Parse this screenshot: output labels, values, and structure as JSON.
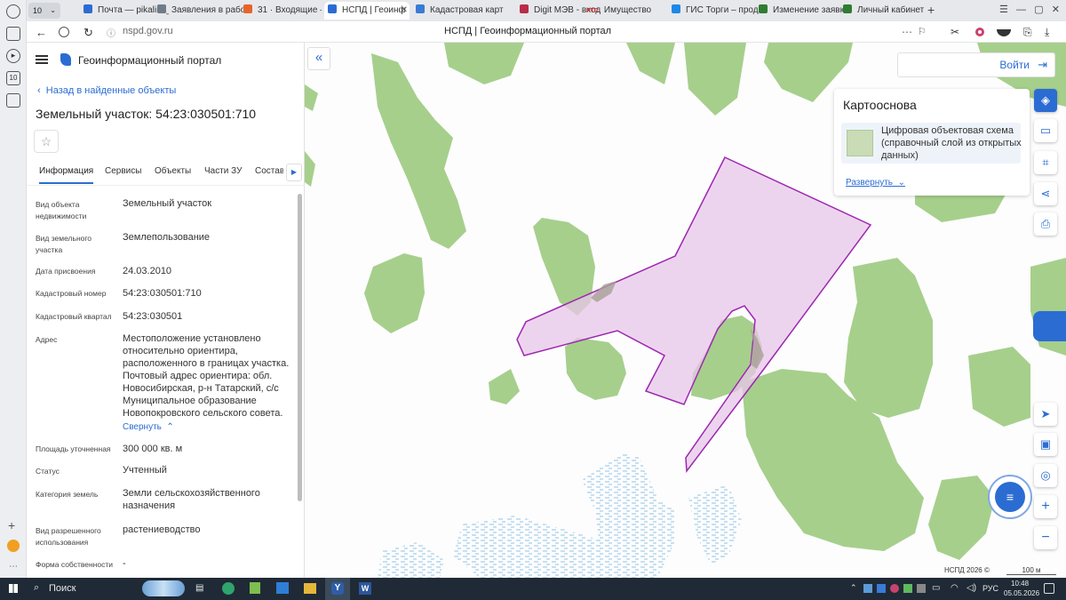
{
  "browser": {
    "tab_counter": "10",
    "tabs": [
      {
        "label": "Почта — pikalina_",
        "icon_color": "#2b6cd3"
      },
      {
        "label": "Заявления в рабо",
        "icon_color": "#6e7c8a"
      },
      {
        "label": "31 · Входящие — Я",
        "icon_color": "#e8632b"
      },
      {
        "label": "НСПД | Геоинф",
        "icon_color": "#2b6cd3"
      },
      {
        "label": "Кадастровая карт",
        "icon_color": "#3a7bd5"
      },
      {
        "label": "Digit МЭВ - вход",
        "icon_color": "#b82c4a"
      },
      {
        "label": "Имущество",
        "icon_color": "#d32f2f"
      },
      {
        "label": "ГИС Торги – прод",
        "icon_color": "#1e88e5"
      },
      {
        "label": "Изменение заявк",
        "icon_color": "#2e7d32"
      },
      {
        "label": "Личный кабинет",
        "icon_color": "#2e7d32"
      }
    ],
    "rtc_tag": "РТС",
    "url": "nspd.gov.ru",
    "page_title": "НСПД | Геоинформационный портал"
  },
  "panel": {
    "portal_title": "Геоинформационный портал",
    "back_link": "Назад в найденные объекты",
    "object_title": "Земельный участок: 54:23:030501:710",
    "tabs": [
      "Информация",
      "Сервисы",
      "Объекты",
      "Части ЗУ",
      "Состав"
    ],
    "fields": [
      {
        "label": "Вид объекта недвижимости",
        "value": "Земельный участок"
      },
      {
        "label": "Вид земельного участка",
        "value": "Землепользование"
      },
      {
        "label": "Дата присвоения",
        "value": "24.03.2010"
      },
      {
        "label": "Кадастровый номер",
        "value": "54:23:030501:710"
      },
      {
        "label": "Кадастровый квартал",
        "value": "54:23:030501"
      },
      {
        "label": "Адрес",
        "value": "Местоположение установлено относительно ориентира, расположенного в границах участка. Почтовый адрес ориентира: обл. Новосибирская, р-н Татарский, с/с Муниципальное образование Новопокровского сельского совета."
      },
      {
        "label": "Площадь уточненная",
        "value": "300 000 кв. м"
      },
      {
        "label": "Статус",
        "value": "Учтенный"
      },
      {
        "label": "Категория земель",
        "value": "Земли сельскохозяйственного назначения"
      },
      {
        "label": "Вид разрешенного использования",
        "value": "растениеводство"
      },
      {
        "label": "Форма собственности",
        "value": "-"
      }
    ],
    "collapse_link": "Свернуть"
  },
  "map": {
    "login_label": "Войти",
    "basemap_title": "Картооснова",
    "basemap_layer": "Цифровая объектовая схема (справочный слой из открытых данных)",
    "expand_link": "Развернуть",
    "copyright": "НСПД 2026 ©",
    "scale": "100 м",
    "colors": {
      "forest": "#a6cf8c",
      "parcel_fill": "#e7c6e8",
      "parcel_stroke": "#9c27b0",
      "accent": "#2b6cd3"
    }
  },
  "taskbar": {
    "search_label": "Поиск",
    "language": "РУС",
    "time": "10:48",
    "date": "05.05.2026"
  }
}
